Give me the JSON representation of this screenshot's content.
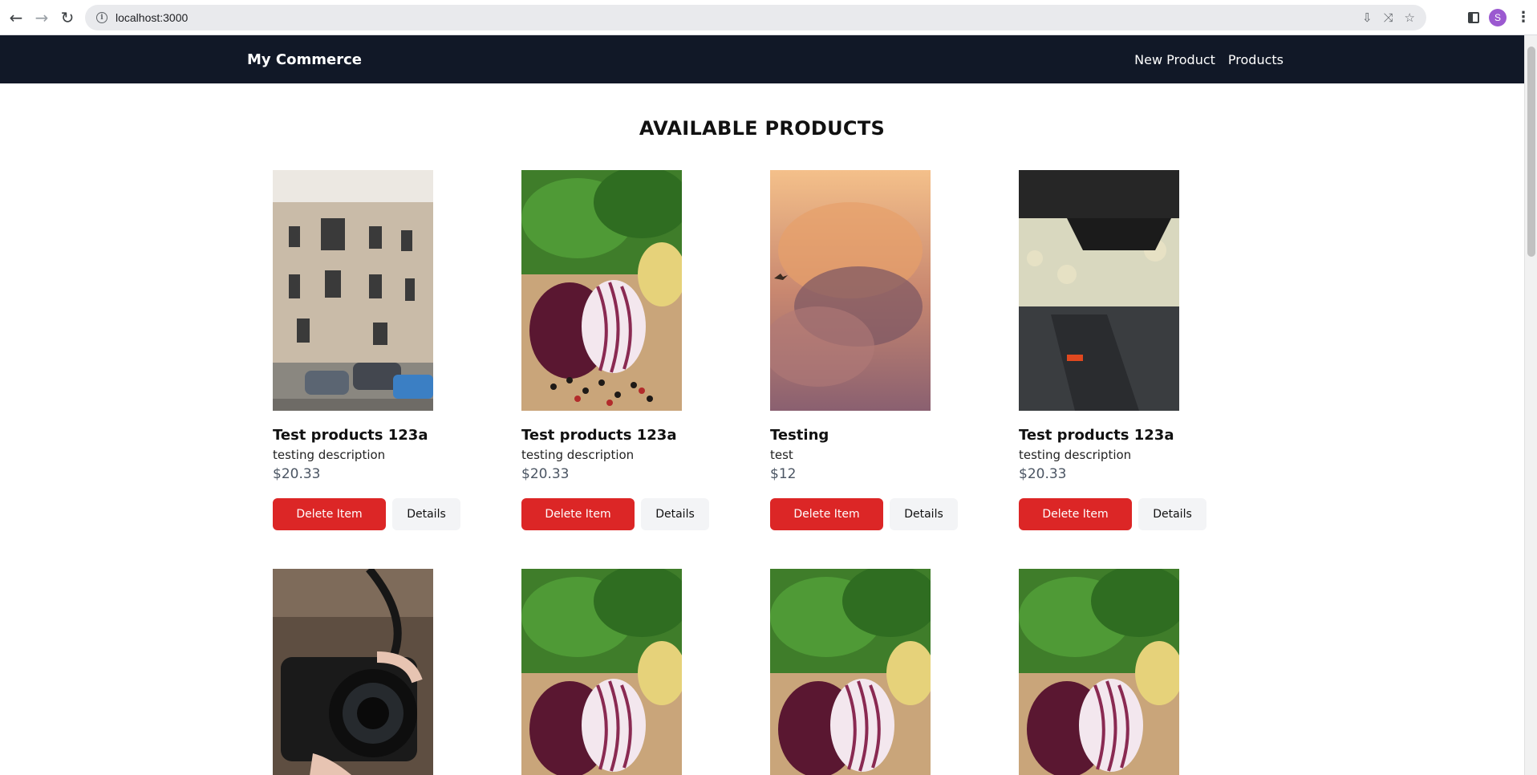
{
  "browser": {
    "url": "localhost:3000",
    "avatar_letter": "S"
  },
  "nav": {
    "brand": "My Commerce",
    "links": [
      "New Product",
      "Products"
    ]
  },
  "heading": "AVAILABLE PRODUCTS",
  "colors": {
    "navbar": "#111827",
    "delete": "#dc2626",
    "details": "#f3f4f6"
  },
  "buttons": {
    "delete": "Delete Item",
    "details": "Details"
  },
  "products": [
    {
      "title": "Test products 123a",
      "description": "testing description",
      "price": "$20.33",
      "image": "building"
    },
    {
      "title": "Test products 123a",
      "description": "testing description",
      "price": "$20.33",
      "image": "onion"
    },
    {
      "title": "Testing",
      "description": "test",
      "price": "$12",
      "image": "sky"
    },
    {
      "title": "Test products 123a",
      "description": "testing description",
      "price": "$20.33",
      "image": "industrial"
    },
    {
      "title": "",
      "description": "",
      "price": "",
      "image": "camera"
    },
    {
      "title": "",
      "description": "",
      "price": "",
      "image": "onion"
    },
    {
      "title": "",
      "description": "",
      "price": "",
      "image": "onion"
    },
    {
      "title": "",
      "description": "",
      "price": "",
      "image": "onion"
    }
  ]
}
